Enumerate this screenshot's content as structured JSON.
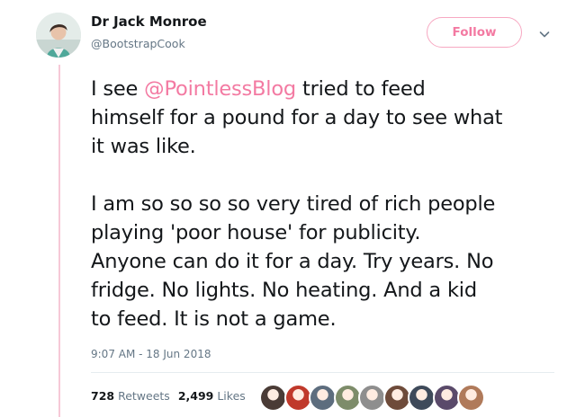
{
  "author": {
    "display_name": "Dr Jack Monroe",
    "handle": "@BootstrapCook",
    "avatar_icon": "profile-photo-avatar"
  },
  "follow_button": {
    "label": "Follow"
  },
  "menu_icon": "chevron-down-icon",
  "tweet": {
    "lines": [
      {
        "before": "I see ",
        "mention": "@PointlessBlog",
        "after": " tried to feed"
      },
      {
        "text": "himself for a pound for a day to see what"
      },
      {
        "text": "it was like."
      },
      {
        "text": ""
      },
      {
        "text": "I am so so so so very tired of rich people"
      },
      {
        "text": "playing 'poor house' for publicity."
      },
      {
        "text": "Anyone can do it for a day. Try years. No"
      },
      {
        "text": "fridge. No lights. No heating. And a kid"
      },
      {
        "text": "to feed. It is not a game."
      }
    ]
  },
  "timestamp": "9:07 AM - 18 Jun 2018",
  "stats": {
    "retweets_count": "728",
    "retweets_label": "Retweets",
    "likes_count": "2,499",
    "likes_label": "Likes"
  },
  "liker_avatars": [
    {
      "color": "#4a3b36",
      "icon": "liker-avatar-icon"
    },
    {
      "color": "#c0392b",
      "icon": "liker-avatar-icon"
    },
    {
      "color": "#5d6d7e",
      "icon": "liker-avatar-icon"
    },
    {
      "color": "#7d8c6a",
      "icon": "liker-avatar-icon"
    },
    {
      "color": "#8e8e8e",
      "icon": "liker-avatar-icon"
    },
    {
      "color": "#6e4b3a",
      "icon": "liker-avatar-icon"
    },
    {
      "color": "#3e4a5a",
      "icon": "liker-avatar-icon"
    },
    {
      "color": "#5a4a6a",
      "icon": "liker-avatar-icon"
    },
    {
      "color": "#b07a5a",
      "icon": "liker-avatar-icon"
    }
  ],
  "colors": {
    "accent_pink": "#f37aa2",
    "thread_line": "#f6c9d7",
    "secondary_text": "#657786",
    "primary_text": "#14171a"
  }
}
